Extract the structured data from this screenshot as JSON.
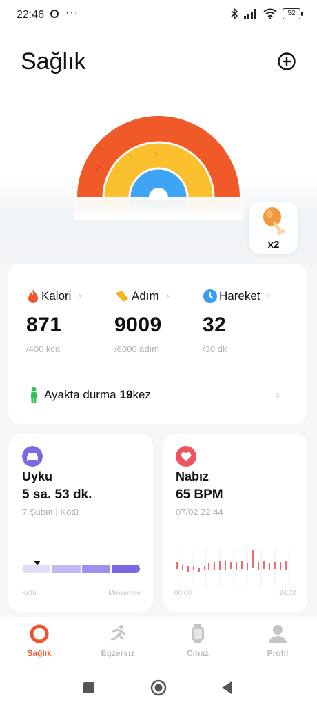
{
  "status_bar": {
    "time": "22:46",
    "dots": "···",
    "battery": "52"
  },
  "header": {
    "title": "Sağlık"
  },
  "reward": {
    "count": "x2"
  },
  "activity": {
    "metrics": [
      {
        "label": "Kalori",
        "value": "871",
        "goal": "/400 kcal",
        "color": "#f0552d"
      },
      {
        "label": "Adım",
        "value": "9009",
        "goal": "/6000 adım",
        "color": "#f8b617"
      },
      {
        "label": "Hareket",
        "value": "32",
        "goal": "/30 dk",
        "color": "#3b9cf5"
      }
    ],
    "standing": {
      "label": "Ayakta durma",
      "count": "19",
      "unit": "kez"
    }
  },
  "sleep": {
    "title": "Uyku",
    "value": "5 sa. 53 dk.",
    "sub": "7 Şubat | Kötü",
    "scale_low": "Kötü",
    "scale_high": "Mükemmel",
    "bar_colors": [
      "#e2dcf7",
      "#c4b8f2",
      "#a08fec",
      "#7a69e4"
    ]
  },
  "pulse": {
    "title": "Nabız",
    "value": "65 BPM",
    "sub": "07/02 22:44",
    "time_start": "00:00",
    "time_end": "24:00"
  },
  "nav": {
    "items": [
      {
        "label": "Sağlık",
        "active": true
      },
      {
        "label": "Egzersiz",
        "active": false
      },
      {
        "label": "Cihaz",
        "active": false
      },
      {
        "label": "Profil",
        "active": false
      }
    ]
  }
}
